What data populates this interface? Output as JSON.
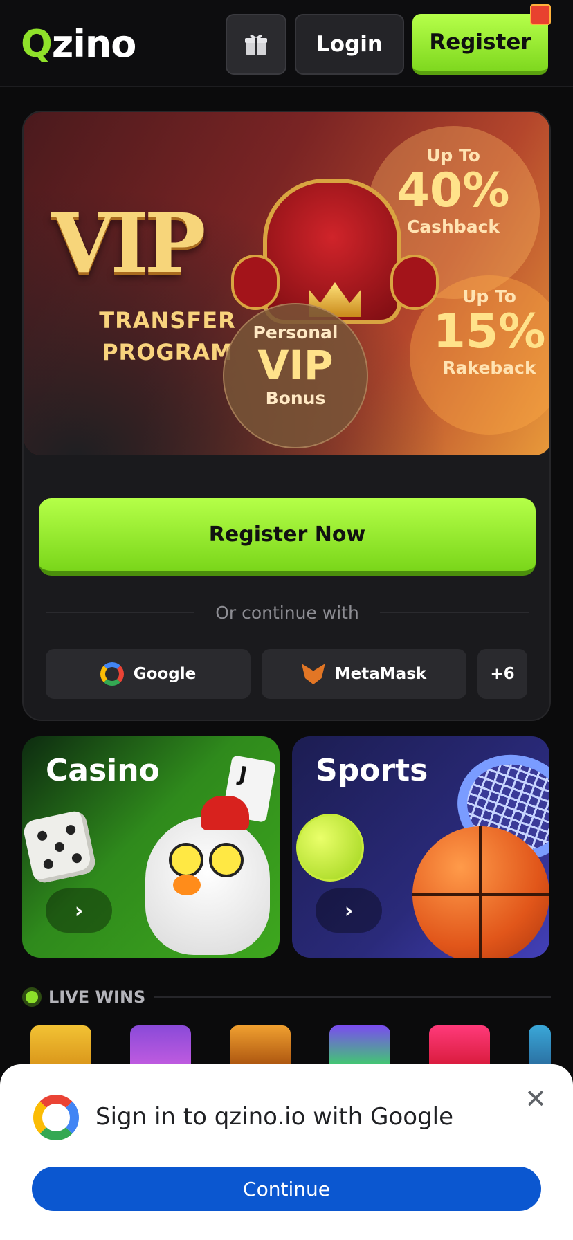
{
  "header": {
    "logo_q": "Q",
    "logo_rest": "zino",
    "login_label": "Login",
    "register_label": "Register"
  },
  "promo": {
    "vip_title": "VIP",
    "transfer_line1": "TRANSFER",
    "transfer_line2": "PROGRAM",
    "cashback": {
      "prefix": "Up To",
      "value": "40%",
      "label": "Cashback"
    },
    "rakeback": {
      "prefix": "Up To",
      "value": "15%",
      "label": "Rakeback"
    },
    "personal": {
      "prefix": "Personal",
      "value": "VIP",
      "label": "Bonus"
    },
    "register_now_label": "Register Now",
    "divider_text": "Or continue with",
    "social": {
      "google_label": "Google",
      "metamask_label": "MetaMask",
      "more_label": "+6"
    }
  },
  "categories": {
    "casino": {
      "title": "Casino",
      "card_letter": "J",
      "arrow": "›"
    },
    "sports": {
      "title": "Sports",
      "arrow": "›"
    }
  },
  "live_wins": {
    "label": "LIVE WINS"
  },
  "google_sheet": {
    "title": "Sign in to qzino.io with Google",
    "close_glyph": "✕",
    "continue_label": "Continue"
  },
  "colors": {
    "accent_green": "#8fe12a",
    "google_blue": "#0b57d0",
    "background": "#0b0b0c"
  }
}
